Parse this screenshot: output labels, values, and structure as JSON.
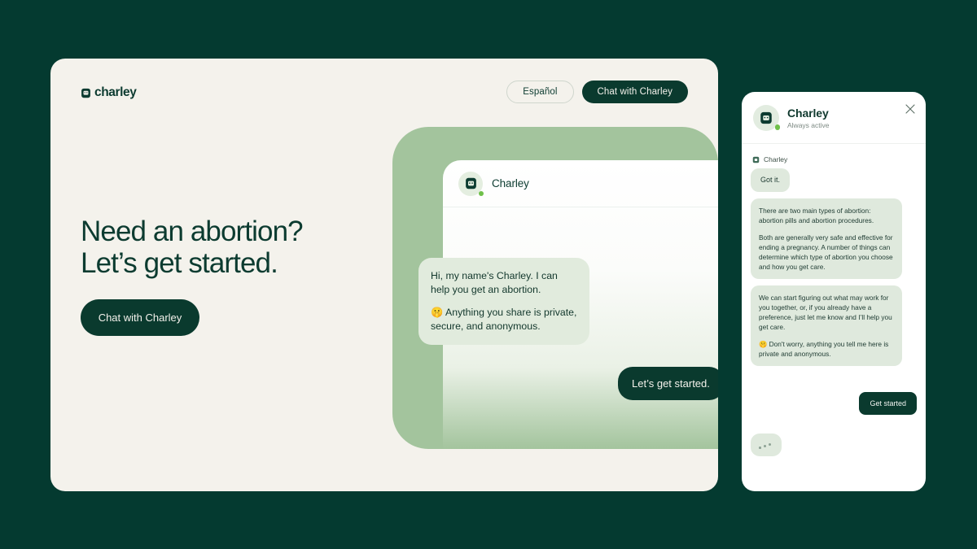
{
  "brand": {
    "name": "charley",
    "logo_icon": "charley-face-icon"
  },
  "header": {
    "language_button": "Español",
    "chat_button": "Chat with Charley"
  },
  "hero": {
    "headline_line1": "Need an abortion?",
    "headline_line2": "Let’s get started.",
    "cta": "Chat with Charley"
  },
  "illustration": {
    "avatar_icon": "charley-bot-avatar-icon",
    "status_dot": "online-dot",
    "name": "Charley",
    "incoming_p1": "Hi, my name's Charley. I can help you get an abortion.",
    "incoming_p2": "🤫 Anything you share is private, secure, and anonymous.",
    "outgoing": "Let’s get started."
  },
  "widget": {
    "avatar_icon": "charley-bot-avatar-icon",
    "title": "Charley",
    "status": "Always active",
    "close_icon": "close-icon",
    "sender_label": "Charley",
    "sender_icon": "charley-mini-icon",
    "messages": [
      {
        "type": "short",
        "text": "Got it."
      },
      {
        "type": "long",
        "paragraphs": [
          "There are two main types of abortion: abortion pills and abortion procedures.",
          "Both are generally very safe and effective for ending a pregnancy. A number of things can determine which type of abortion you choose and how you get care."
        ]
      },
      {
        "type": "long",
        "paragraphs": [
          "We can start figuring out what may work for you together, or, if you already have a preference, just let me know and I’ll help you get care.",
          "🤫 Don't worry, anything you tell me here is private and anonymous."
        ]
      }
    ],
    "cta": "Get started",
    "typing_indicator": "typing-indicator"
  },
  "colors": {
    "page_background": "#043a30",
    "card_background": "#f4f2ec",
    "brand_dark": "#0a3a2e",
    "illustration_green": "#a3c49d",
    "bubble_green": "#dfe9dd",
    "online_green": "#6fc04a"
  }
}
